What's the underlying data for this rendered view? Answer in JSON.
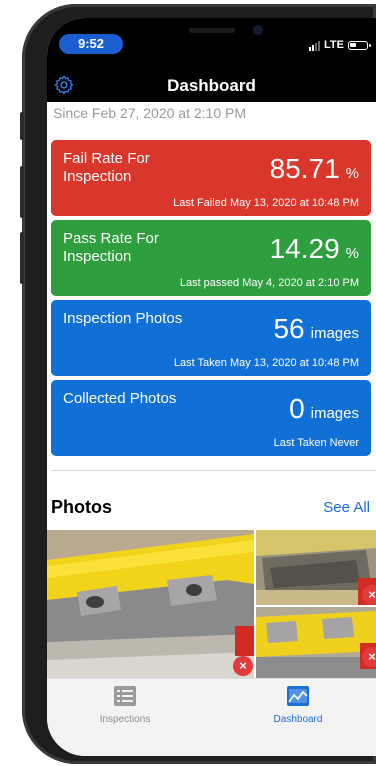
{
  "status_bar": {
    "time": "9:52",
    "network": "LTE"
  },
  "nav": {
    "title": "Dashboard",
    "settings_icon": "gear-icon"
  },
  "since_text": "Since Feb 27, 2020 at 2:10 PM",
  "cards": [
    {
      "label": "Fail Rate For Inspection",
      "value": "85.71",
      "unit": "%",
      "sub": "Last Failed May 13, 2020 at 10:48 PM",
      "color": "#d9362c"
    },
    {
      "label": "Pass Rate For Inspection",
      "value": "14.29",
      "unit": "%",
      "sub": "Last passed May 4, 2020 at 2:10 PM",
      "color": "#2e9e3e"
    },
    {
      "label": "Inspection Photos",
      "value": "56",
      "unit": "images",
      "sub": "Last Taken May 13, 2020 at 10:48 PM",
      "color": "#1170d6"
    },
    {
      "label": "Collected Photos",
      "value": "0",
      "unit": "images",
      "sub": "Last Taken Never",
      "color": "#1170d6"
    }
  ],
  "photos": {
    "title": "Photos",
    "see_all": "See All",
    "delete_icon": "close-icon",
    "delete_glyph": "×"
  },
  "tabbar": {
    "items": [
      {
        "label": "Inspections",
        "icon": "list-icon",
        "active": false
      },
      {
        "label": "Dashboard",
        "icon": "chart-icon",
        "active": true
      }
    ],
    "active_color": "#1a6ed6",
    "inactive_color": "#8e8e8e"
  }
}
